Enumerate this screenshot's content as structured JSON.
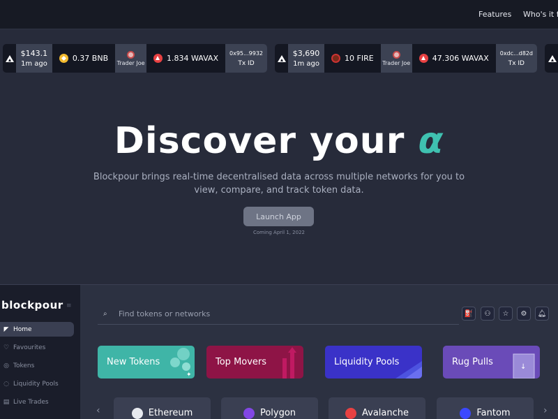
{
  "nav": {
    "links": [
      "Features",
      "Who's it f"
    ]
  },
  "ticker": [
    {
      "price": "$143.1",
      "time": "1m ago",
      "token1_amount": "0.37 BNB",
      "token1_icon": "bnb-icon",
      "dex": "Trader Joe",
      "token2_amount": "1.834 WAVAX",
      "token2_icon": "avax-icon",
      "tx_hash": "0x95...9932",
      "tx_label": "Tx ID"
    },
    {
      "price": "$3,690",
      "time": "1m ago",
      "token1_amount": "10 FIRE",
      "token1_icon": "fire-icon",
      "dex": "Trader Joe",
      "token2_amount": "47.306 WAVAX",
      "token2_icon": "avax-icon",
      "tx_hash": "0xdc...d82d",
      "tx_label": "Tx ID"
    }
  ],
  "hero": {
    "title": "Discover your",
    "title_symbol": "α",
    "subtitle": "Blockpour brings real-time decentralised data across multiple networks for you to view, compare, and track token data.",
    "cta": "Launch App",
    "cta_note": "Coming April 1, 2022"
  },
  "app": {
    "brand": "blockpour",
    "sidebar": [
      {
        "label": "Home",
        "icon": "twitter-bird-icon",
        "active": true
      },
      {
        "label": "Favourites",
        "icon": "heart-icon"
      },
      {
        "label": "Tokens",
        "icon": "coins-icon"
      },
      {
        "label": "Liquidity Pools",
        "icon": "pool-icon"
      },
      {
        "label": "Live Trades",
        "icon": "trades-icon"
      }
    ],
    "search_placeholder": "Find tokens or networks",
    "toolbar_icons": [
      "gas-icon",
      "token-swap-icon",
      "star-icon",
      "settings-icon",
      "bell-icon"
    ],
    "categories": [
      {
        "label": "New Tokens",
        "color": "#3fb5a7"
      },
      {
        "label": "Top Movers",
        "color": "#8e1446"
      },
      {
        "label": "Liquidity Pools",
        "color": "#3a32c8"
      },
      {
        "label": "Rug Pulls",
        "color": "#6a4bb8"
      }
    ],
    "networks": [
      {
        "label": "Ethereum",
        "icon": "ethereum-icon"
      },
      {
        "label": "Polygon",
        "icon": "polygon-icon"
      },
      {
        "label": "Avalanche",
        "icon": "avalanche-icon"
      },
      {
        "label": "Fantom",
        "icon": "fantom-icon"
      }
    ]
  },
  "colors": {
    "accent": "#3fc1b0",
    "background": "#272b3a",
    "card": "#141722"
  }
}
